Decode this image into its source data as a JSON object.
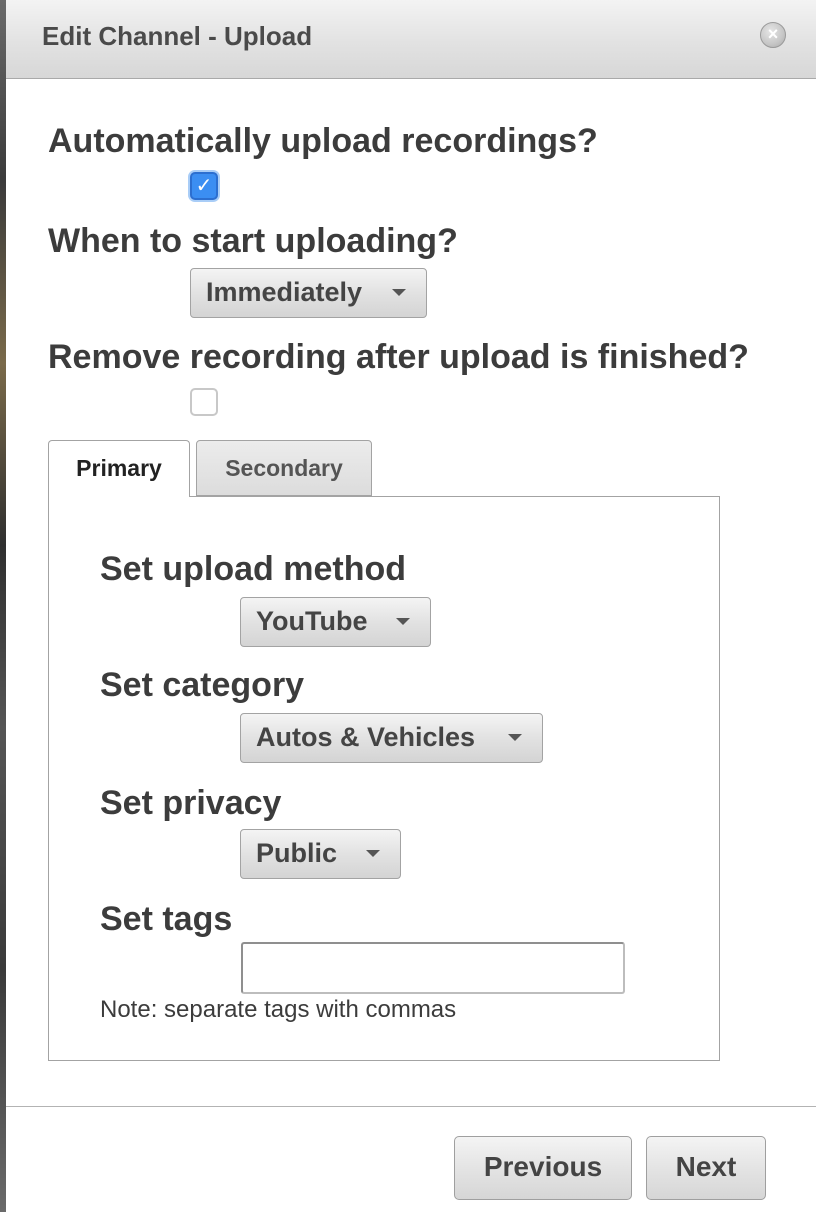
{
  "dialog": {
    "title": "Edit Channel - Upload",
    "close_icon": "close-circle-icon"
  },
  "auto_upload": {
    "label": "Automatically upload recordings?",
    "checked": true,
    "check_mark": "✓"
  },
  "start_upload": {
    "label": "When to start uploading?",
    "selected": "Immediately"
  },
  "remove_after": {
    "label": "Remove recording after upload is finished?",
    "checked": false
  },
  "tabs": [
    {
      "label": "Primary",
      "active": true
    },
    {
      "label": "Secondary",
      "active": false
    }
  ],
  "primary": {
    "upload_method": {
      "label": "Set upload method",
      "selected": "YouTube"
    },
    "category": {
      "label": "Set category",
      "selected": "Autos & Vehicles"
    },
    "privacy": {
      "label": "Set privacy",
      "selected": "Public"
    },
    "tags": {
      "label": "Set tags",
      "value": "",
      "note": "Note: separate tags with commas"
    }
  },
  "footer": {
    "previous_label": "Previous",
    "next_label": "Next"
  },
  "colors": {
    "checkbox_checked": "#3b8ef2",
    "titlebar": "#e2e2e2"
  }
}
